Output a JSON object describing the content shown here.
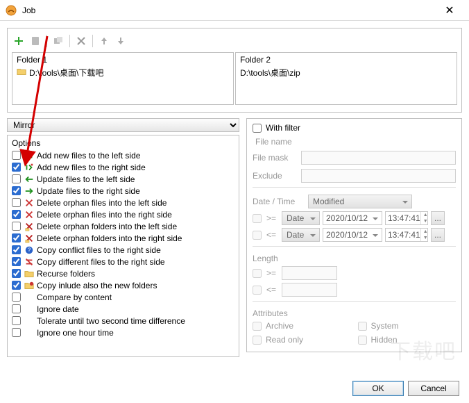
{
  "window": {
    "title": "Job"
  },
  "folders": {
    "left": {
      "label": "Folder 1",
      "path": "D:\\tools\\桌面\\下载吧"
    },
    "right": {
      "label": "Folder 2",
      "path": "D:\\tools\\桌面\\zip"
    }
  },
  "mode": {
    "selected": "Mirror"
  },
  "options": {
    "group_label": "Options",
    "items": [
      {
        "checked": false,
        "icon": "add-left",
        "label": "Add new files to the left side"
      },
      {
        "checked": true,
        "icon": "add-right",
        "label": "Add new files to the right side"
      },
      {
        "checked": false,
        "icon": "update-left",
        "label": "Update files to the left side"
      },
      {
        "checked": true,
        "icon": "update-right",
        "label": "Update files to the right side"
      },
      {
        "checked": false,
        "icon": "del-left",
        "label": "Delete orphan files into the left side"
      },
      {
        "checked": true,
        "icon": "del-right",
        "label": "Delete orphan files into the right side"
      },
      {
        "checked": false,
        "icon": "delf-left",
        "label": "Delete orphan folders into the left side"
      },
      {
        "checked": true,
        "icon": "delf-right",
        "label": "Delete orphan folders into the right side"
      },
      {
        "checked": true,
        "icon": "conflict",
        "label": "Copy conflict files to the right side"
      },
      {
        "checked": true,
        "icon": "different",
        "label": "Copy different files to the right side"
      },
      {
        "checked": true,
        "icon": "recurse",
        "label": "Recurse folders"
      },
      {
        "checked": true,
        "icon": "newfolders",
        "label": "Copy inlude also the new folders"
      },
      {
        "checked": false,
        "icon": "",
        "label": "Compare by content",
        "indent": true
      },
      {
        "checked": false,
        "icon": "",
        "label": "Ignore date",
        "indent": true
      },
      {
        "checked": false,
        "icon": "",
        "label": "Tolerate until two second time difference",
        "indent": true
      },
      {
        "checked": false,
        "icon": "",
        "label": "Ignore one hour time",
        "indent": true
      }
    ]
  },
  "filter": {
    "with_filter_label": "With filter",
    "with_filter_checked": false,
    "file_name_label": "File name",
    "file_mask_label": "File mask",
    "exclude_label": "Exclude",
    "date_time_label": "Date / Time",
    "modified_label": "Modified",
    "ge_label": ">=",
    "le_label": "<=",
    "date_label": "Date",
    "date_value": "2020/10/12",
    "time_value": "13:47:41",
    "dots_label": "...",
    "length_label": "Length",
    "attributes_label": "Attributes",
    "attr_archive": "Archive",
    "attr_system": "System",
    "attr_readonly": "Read only",
    "attr_hidden": "Hidden"
  },
  "buttons": {
    "ok": "OK",
    "cancel": "Cancel"
  },
  "watermark": "下载吧"
}
